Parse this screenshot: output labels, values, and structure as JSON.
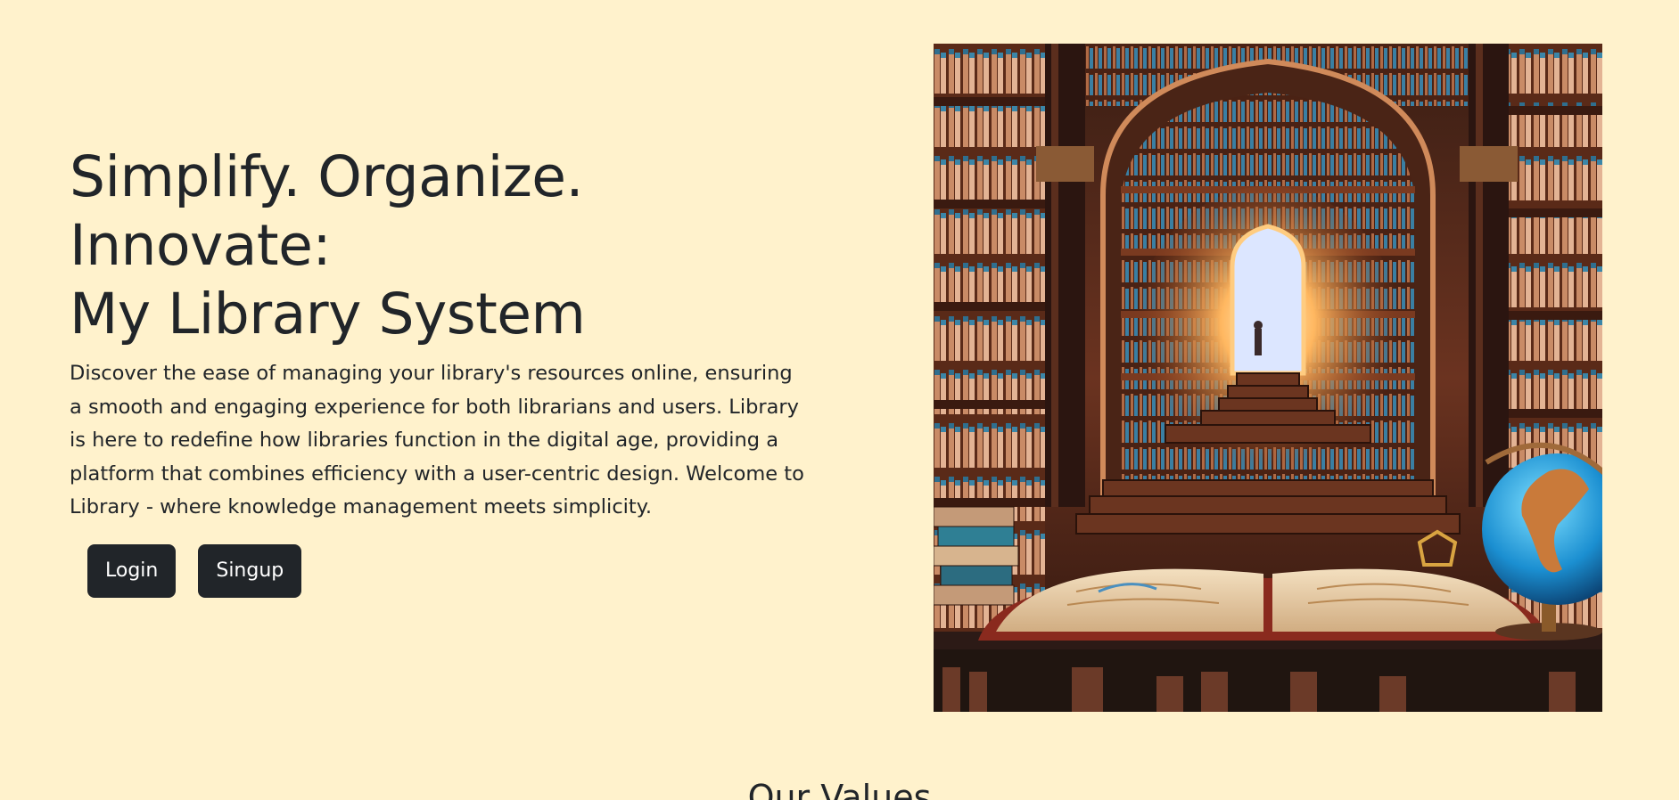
{
  "hero": {
    "title_line1": "Simplify. Organize. Innovate:",
    "title_line2": "My Library System",
    "description": "Discover the ease of managing your library's resources online, ensuring a smooth and engaging experience for both librarians and users. Library is here to redefine how libraries function in the digital age, providing a platform that combines efficiency with a user-centric design. Welcome to Library - where knowledge management meets simplicity.",
    "login_label": "Login",
    "signup_label": "Singup"
  },
  "values_section": {
    "title": "Our Values"
  },
  "colors": {
    "background": "#fff2cc",
    "button": "#212529",
    "text": "#212529"
  }
}
